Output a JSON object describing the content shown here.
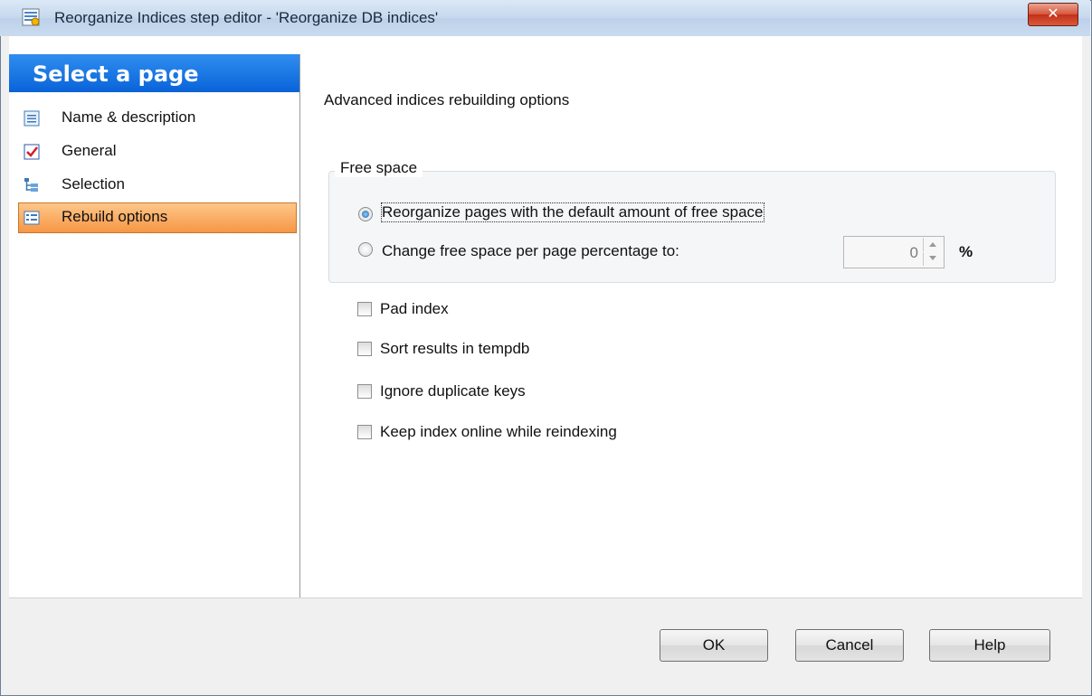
{
  "window": {
    "title": "Reorganize Indices step editor - 'Reorganize DB indices'",
    "close_icon": "close-x"
  },
  "sidebar": {
    "header": "Select a page",
    "items": [
      {
        "label": "Name & description",
        "icon": "list-doc-icon"
      },
      {
        "label": "General",
        "icon": "checkbox-icon"
      },
      {
        "label": "Selection",
        "icon": "tree-icon"
      },
      {
        "label": "Rebuild options",
        "icon": "options-icon",
        "active": true
      }
    ]
  },
  "main": {
    "title": "Advanced indices rebuilding options",
    "free_space": {
      "label": "Free space",
      "option_default": "Reorganize pages with the default amount of free space",
      "option_change": "Change free space per page percentage to:",
      "selected": "default",
      "percentage_value": "0",
      "percent_sign": "%"
    },
    "checkboxes": [
      {
        "label": "Pad index",
        "checked": false
      },
      {
        "label": "Sort results in tempdb",
        "checked": false
      },
      {
        "label": "Ignore duplicate keys",
        "checked": false
      },
      {
        "label": "Keep index online while reindexing",
        "checked": false
      }
    ]
  },
  "buttons": {
    "ok": "OK",
    "cancel": "Cancel",
    "help": "Help"
  },
  "colors": {
    "sidebar_header": "#1a76e6",
    "active_item": "#f79645",
    "close_button": "#c3301b"
  }
}
